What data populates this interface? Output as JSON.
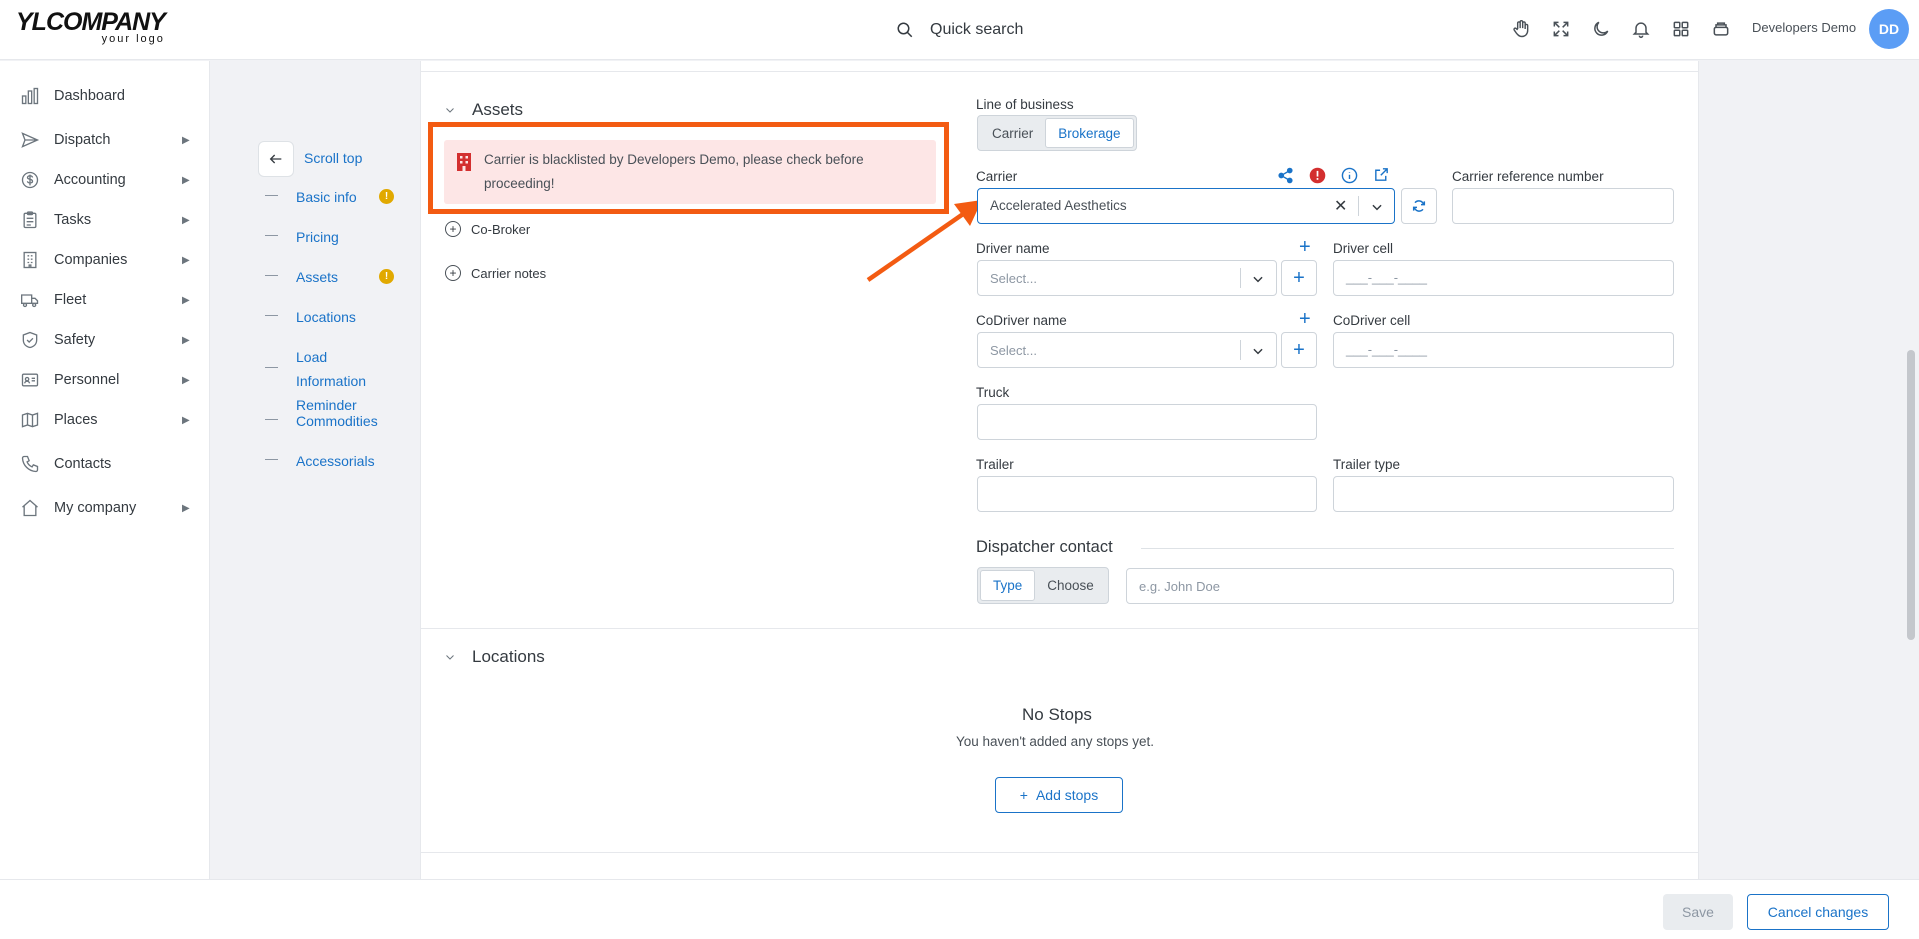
{
  "header": {
    "logo_main": "YLCOMPANY",
    "logo_sub": "your logo",
    "search_label": "Quick search",
    "user_name": "Developers Demo",
    "avatar_initials": "DD"
  },
  "sidebar": {
    "items": [
      {
        "label": "Dashboard",
        "icon": "chart-bar-icon"
      },
      {
        "label": "Dispatch",
        "icon": "send-icon"
      },
      {
        "label": "Accounting",
        "icon": "dollar-icon"
      },
      {
        "label": "Tasks",
        "icon": "clipboard-icon"
      },
      {
        "label": "Companies",
        "icon": "building-icon"
      },
      {
        "label": "Fleet",
        "icon": "truck-icon"
      },
      {
        "label": "Safety",
        "icon": "shield-icon"
      },
      {
        "label": "Personnel",
        "icon": "id-card-icon"
      },
      {
        "label": "Places",
        "icon": "map-icon"
      },
      {
        "label": "Contacts",
        "icon": "phone-icon"
      },
      {
        "label": "My company",
        "icon": "home-icon"
      }
    ]
  },
  "section_nav": {
    "scroll_top": "Scroll top",
    "items": [
      {
        "label": "Basic info",
        "warning": "!"
      },
      {
        "label": "Pricing"
      },
      {
        "label": "Assets",
        "warning": "!"
      },
      {
        "label": "Locations"
      },
      {
        "label": "Load Information Reminder"
      },
      {
        "label": "Commodities"
      },
      {
        "label": "Accessorials"
      }
    ]
  },
  "assets": {
    "title": "Assets",
    "alert": "Carrier is blacklisted by Developers Demo, please check before proceeding!",
    "co_broker": "Co-Broker",
    "carrier_notes": "Carrier notes",
    "line_of_business_label": "Line of business",
    "lob_options": [
      "Carrier",
      "Brokerage"
    ],
    "carrier_label": "Carrier",
    "carrier_value": "Accelerated Aesthetics",
    "carrier_ref_label": "Carrier reference number",
    "driver_name_label": "Driver name",
    "driver_cell_label": "Driver cell",
    "codriver_name_label": "CoDriver name",
    "codriver_cell_label": "CoDriver cell",
    "select_placeholder": "Select...",
    "phone_placeholder": "___-___-____",
    "truck_label": "Truck",
    "trailer_label": "Trailer",
    "trailer_type_label": "Trailer type",
    "dispatcher_contact_label": "Dispatcher contact",
    "dispatcher_modes": [
      "Type",
      "Choose"
    ],
    "dispatcher_placeholder": "e.g. John Doe"
  },
  "locations": {
    "title": "Locations",
    "empty_title": "No Stops",
    "empty_sub": "You haven't added any stops yet.",
    "add_button": "Add stops"
  },
  "footer": {
    "save": "Save",
    "cancel": "Cancel changes"
  },
  "colors": {
    "accent": "#1a73c8",
    "alert_bg": "#fde6e6",
    "highlight": "#f35b12",
    "warning": "#e1a900",
    "danger": "#d32f2f"
  }
}
